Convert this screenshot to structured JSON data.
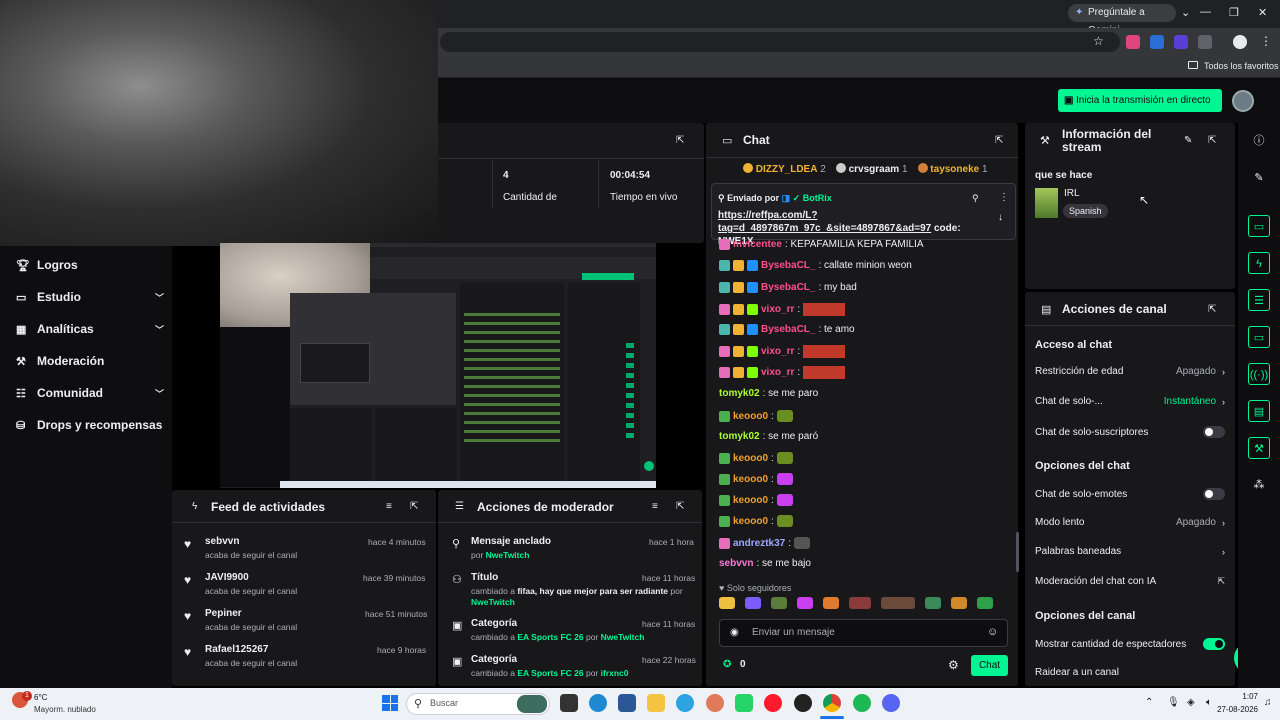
{
  "browser": {
    "gemini_label": "Pregúntale a Gemini",
    "bookmarks_label": "Todos los favoritos"
  },
  "topnav": {
    "go_live_label": "Inicia la transmisión en directo"
  },
  "sidebar": {
    "items": [
      {
        "label": "Logros",
        "icon": "trophy-icon",
        "chevron": false
      },
      {
        "label": "Estudio",
        "icon": "studio-icon",
        "chevron": true
      },
      {
        "label": "Analíticas",
        "icon": "analytics-icon",
        "chevron": true
      },
      {
        "label": "Moderación",
        "icon": "wrench-icon",
        "chevron": false
      },
      {
        "label": "Comunidad",
        "icon": "community-icon",
        "chevron": true
      },
      {
        "label": "Drops y recompensas",
        "icon": "drops-icon",
        "chevron": false
      }
    ]
  },
  "stats": {
    "viewers_value": "4",
    "viewers_label": "Cantidad de",
    "live_time_value": "00:04:54",
    "live_time_label": "Tiempo en vivo"
  },
  "feed": {
    "title": "Feed de actividades",
    "items": [
      {
        "user": "sebvvn",
        "action": "acaba de seguir el canal",
        "time": "hace 4 minutos"
      },
      {
        "user": "JAVI9900",
        "action": "acaba de seguir el canal",
        "time": "hace 39 minutos"
      },
      {
        "user": "Pepiner",
        "action": "acaba de seguir el canal",
        "time": "hace 51 minutos"
      },
      {
        "user": "Rafael125267",
        "action": "acaba de seguir el canal",
        "time": "hace 9 horas"
      }
    ]
  },
  "mod_actions": {
    "title": "Acciones de moderador",
    "items": [
      {
        "title": "Mensaje anclado",
        "prefix": "por ",
        "detail": "NweTwitch",
        "suffix": "",
        "by": "",
        "time": "hace 1 hora"
      },
      {
        "title": "Título",
        "prefix": "cambiado a ",
        "detail": "fifaa, hay que mejor para ser radiante",
        "suffix": " por ",
        "by": "NweTwitch",
        "time": "hace 11 horas"
      },
      {
        "title": "Categoría",
        "prefix": "cambiado a ",
        "detail": "EA Sports FC 26",
        "suffix": " por ",
        "by": "NweTwitch",
        "time": "hace 11 horas"
      },
      {
        "title": "Categoría",
        "prefix": "cambiado a ",
        "detail": "EA Sports FC 26",
        "suffix": " por ",
        "by": "ifrxnc0",
        "time": "hace 22 horas"
      }
    ]
  },
  "chat": {
    "title": "Chat",
    "top_gifters": [
      {
        "name": "DIZZY_LDEA",
        "count": "2",
        "color": "#f0b232"
      },
      {
        "name": "crvsgraam",
        "count": "1",
        "color": "#efeff1"
      },
      {
        "name": "taysoneke",
        "count": "1",
        "color": "#f0b232"
      }
    ],
    "pinned": {
      "sent_by_label": "Enviado por",
      "sender": "BotRix",
      "link": "https://reffpa.com/L?tag=d_4897867m_97c_&site=4897867&ad=97",
      "text": " code: NWE1X"
    },
    "messages": [
      {
        "user": "mvicentee",
        "color": "#ff4f8a",
        "text": ": KEPAFAMILIA KEPA FAMILIA"
      },
      {
        "user": "BysebaCL_",
        "color": "#ff4f8a",
        "text": ": callate minion weon"
      },
      {
        "user": "BysebaCL_",
        "color": "#ff4f8a",
        "text": ": my bad"
      },
      {
        "user": "vixo_rr",
        "color": "#ff4f8a",
        "text": ":"
      },
      {
        "user": "BysebaCL_",
        "color": "#ff4f8a",
        "text": ": te amo"
      },
      {
        "user": "vixo_rr",
        "color": "#ff4f8a",
        "text": ":"
      },
      {
        "user": "vixo_rr",
        "color": "#ff4f8a",
        "text": ":"
      },
      {
        "user": "tomyk02",
        "color": "#adff2f",
        "text": ": se me paro"
      },
      {
        "user": "keooo0",
        "color": "#f0a030",
        "text": ":"
      },
      {
        "user": "tomyk02",
        "color": "#adff2f",
        "text": ": se me paró"
      },
      {
        "user": "keooo0",
        "color": "#f0a030",
        "text": ":"
      },
      {
        "user": "keooo0",
        "color": "#f0a030",
        "text": ":"
      },
      {
        "user": "keooo0",
        "color": "#f0a030",
        "text": ":"
      },
      {
        "user": "keooo0",
        "color": "#f0a030",
        "text": ":"
      },
      {
        "user": "andreztk37",
        "color": "#9fa8ff",
        "text": ":"
      },
      {
        "user": "sebvvn",
        "color": "#ff7ad9",
        "text": ": se me bajo"
      }
    ],
    "followers_only_label": "Solo seguidores",
    "input_placeholder": "Enviar un mensaje",
    "points": "0",
    "send_label": "Chat"
  },
  "stream_info": {
    "title": "Información del stream",
    "stream_title": "que se hace",
    "category": "IRL",
    "language_tag": "Spanish"
  },
  "channel_actions": {
    "title": "Acciones de canal",
    "chat_access_header": "Acceso al chat",
    "age_restriction_label": "Restricción de edad",
    "age_restriction_value": "Apagado",
    "followers_chat_label": "Chat de solo-...",
    "followers_chat_value": "Instantáneo",
    "subs_chat_label": "Chat de solo-suscriptores",
    "chat_options_header": "Opciones del chat",
    "emotes_only_label": "Chat de solo-emotes",
    "slow_mode_label": "Modo lento",
    "slow_mode_value": "Apagado",
    "banned_words_label": "Palabras baneadas",
    "ai_mod_label": "Moderación del chat con IA",
    "channel_options_header": "Opciones del canal",
    "show_viewers_label": "Mostrar cantidad de espectadores",
    "raid_label": "Raidear a un canal"
  },
  "taskbar": {
    "weather_temp": "6°C",
    "weather_desc": "Mayorm. nublado",
    "search_placeholder": "Buscar",
    "time": "1:07",
    "date": "27-08-2026",
    "notif_count": "1"
  }
}
